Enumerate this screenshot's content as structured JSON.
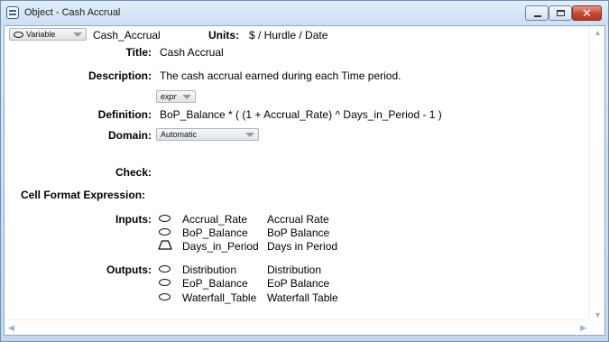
{
  "window": {
    "title": "Object - Cash Accrual",
    "close_glyph": "✕"
  },
  "header": {
    "class_select": "Variable",
    "identifier": "Cash_Accrual",
    "units_label": "Units:",
    "units_value": "$ / Hurdle / Date"
  },
  "fields": {
    "title_label": "Title:",
    "title_value": "Cash Accrual",
    "description_label": "Description:",
    "description_value": "The cash accrual earned during each Time period.",
    "definition_type": "expr",
    "definition_label": "Definition:",
    "definition_value": "BoP_Balance * ( (1 + Accrual_Rate) ^ Days_in_Period - 1 )",
    "domain_label": "Domain:",
    "domain_value": "Automatic",
    "check_label": "Check:",
    "cell_format_label": "Cell Format Expression:"
  },
  "inputs": {
    "label": "Inputs:",
    "items": [
      {
        "icon": "variable-oval-icon",
        "identifier": "Accrual_Rate",
        "title": "Accrual Rate"
      },
      {
        "icon": "variable-oval-icon",
        "identifier": "BoP_Balance",
        "title": "BoP Balance"
      },
      {
        "icon": "index-trapezoid-icon",
        "identifier": "Days_in_Period",
        "title": "Days in Period"
      }
    ]
  },
  "outputs": {
    "label": "Outputs:",
    "items": [
      {
        "icon": "variable-oval-icon",
        "identifier": "Distribution",
        "title": "Distribution"
      },
      {
        "icon": "variable-oval-icon",
        "identifier": "EoP_Balance",
        "title": "EoP Balance"
      },
      {
        "icon": "variable-oval-icon",
        "identifier": "Waterfall_Table",
        "title": "Waterfall Table"
      }
    ]
  }
}
